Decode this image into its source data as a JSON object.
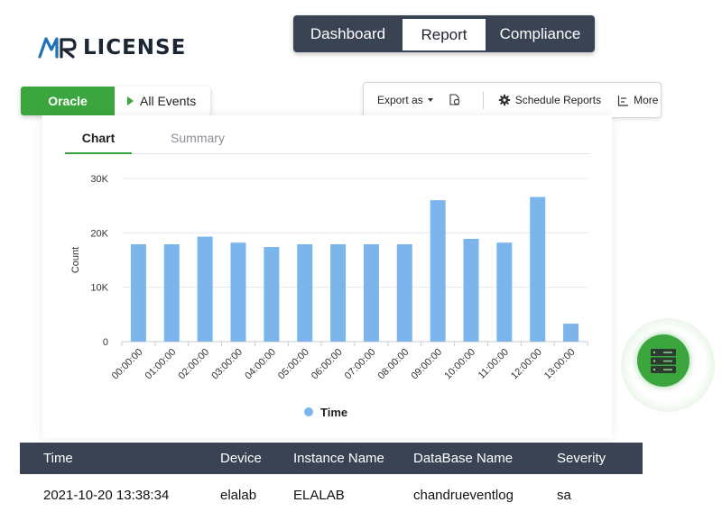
{
  "brand": {
    "logo_text": "LICENSE",
    "logo_mark": "MR"
  },
  "top_nav": {
    "tabs": [
      {
        "label": "Dashboard",
        "active": false
      },
      {
        "label": "Report",
        "active": true
      },
      {
        "label": "Compliance",
        "active": false
      }
    ]
  },
  "source_selector": {
    "database": "Oracle",
    "events": "All Events"
  },
  "toolbar": {
    "export_label": "Export as",
    "schedule_label": "Schedule Reports",
    "more_label": "More"
  },
  "view_tabs": [
    {
      "label": "Chart",
      "active": true
    },
    {
      "label": "Summary",
      "active": false
    }
  ],
  "chart_data": {
    "type": "bar",
    "ylabel": "Count",
    "xlabel": "",
    "ylim": [
      0,
      30000
    ],
    "yticks": [
      "0",
      "10K",
      "20K",
      "30K"
    ],
    "ytick_values": [
      0,
      10000,
      20000,
      30000
    ],
    "grid": true,
    "legend_position": "bottom",
    "categories": [
      "00:00:00",
      "01:00:00",
      "02:00:00",
      "03:00:00",
      "04:00:00",
      "05:00:00",
      "06:00:00",
      "07:00:00",
      "08:00:00",
      "09:00:00",
      "10:00:00",
      "11:00:00",
      "12:00:00",
      "13:00:00"
    ],
    "series": [
      {
        "name": "Time",
        "color": "#7cb5ec",
        "values": [
          17900,
          17900,
          19300,
          18200,
          17400,
          17900,
          17900,
          17900,
          17900,
          26000,
          18900,
          18200,
          26600,
          3300
        ]
      }
    ]
  },
  "table": {
    "headers": [
      "Time",
      "Device",
      "Instance Name",
      "DataBase Name",
      "Severity"
    ],
    "rows": [
      [
        "2021-10-20 13:38:34",
        "elalab",
        "ELALAB",
        "chandrueventlog",
        "sa"
      ]
    ]
  },
  "colors": {
    "accent": "#3ca63e",
    "header_bg": "#3a4354",
    "bar": "#7cb5ec"
  },
  "icons": [
    "export-file-icon",
    "schedule-gear-icon",
    "more-icon",
    "server-icon",
    "play-triangle-icon"
  ]
}
